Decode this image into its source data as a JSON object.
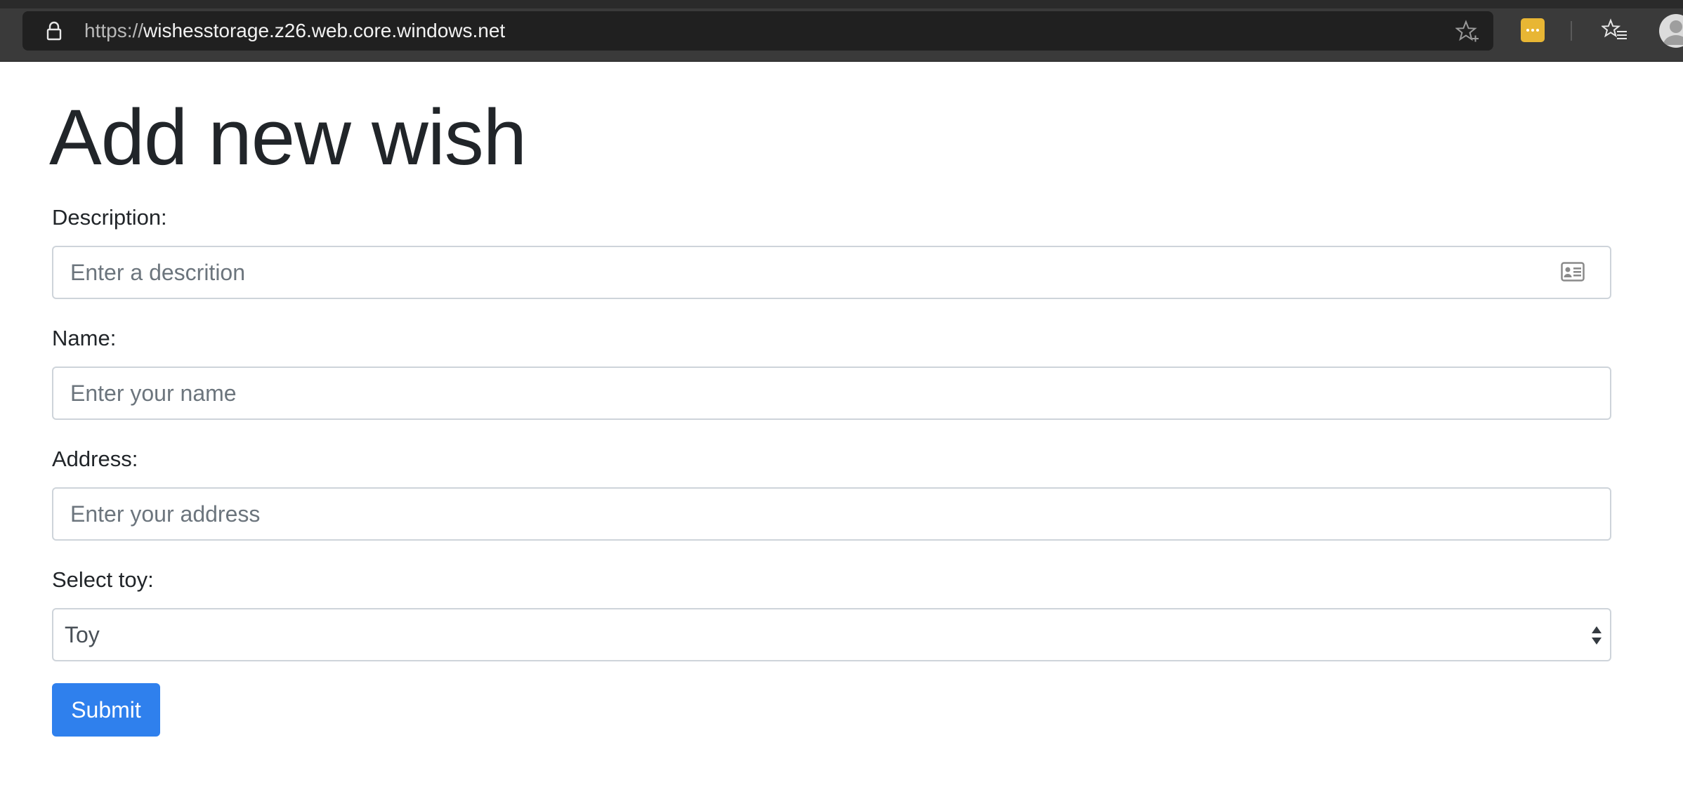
{
  "browser": {
    "url_scheme": "https://",
    "url_host": "wishesstorage.z26.web.core.windows.net"
  },
  "page": {
    "title": "Add new wish"
  },
  "form": {
    "description": {
      "label": "Description:",
      "placeholder": "Enter a descrition",
      "value": ""
    },
    "name": {
      "label": "Name:",
      "placeholder": "Enter your name",
      "value": ""
    },
    "address": {
      "label": "Address:",
      "placeholder": "Enter your address",
      "value": ""
    },
    "toy": {
      "label": "Select toy:",
      "selected": "Toy"
    },
    "submit_label": "Submit"
  },
  "icons": {
    "lock": "lock-icon",
    "star": "star-icon",
    "extension": "extension-icon",
    "favorites": "favorites-icon",
    "profile": "profile-icon",
    "contact_card": "contact-card-icon"
  },
  "colors": {
    "primary": "#2f80ed",
    "chrome_bg": "#3a3a3a",
    "address_bg": "#202020",
    "extension": "#e8b634",
    "text": "#212529",
    "placeholder": "#6c757d",
    "border": "#ced4da"
  }
}
